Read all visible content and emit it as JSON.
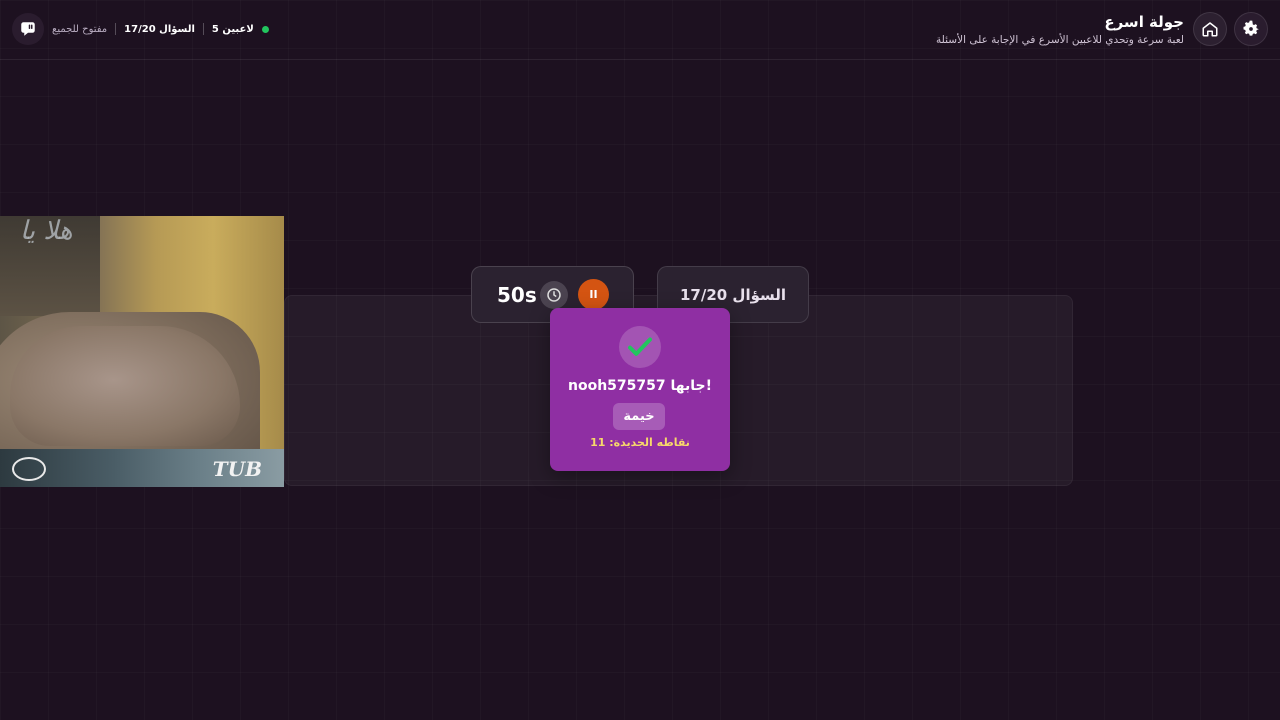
{
  "header": {
    "title": "جولة اسرع",
    "subtitle": "لعبة سرعة وتحدي للاعبين الأسرع في الإجابة على الأسئلة",
    "icons": {
      "settings": "gear-icon",
      "home": "home-icon",
      "chat": "chat-icon"
    }
  },
  "status": {
    "players": "5 لاعبين",
    "question": "السؤال 17/20",
    "mode": "مفتوح للجميع",
    "online_color": "#22c55e"
  },
  "game": {
    "timer": "50s",
    "question_label": "السؤال 17/20",
    "pause_glyph": "II",
    "accent_color": "#d45412"
  },
  "popup": {
    "winner_line": "nooh575757 جابها!",
    "answer": "خيمة",
    "points_line": "نقاطه الجديدة: 11",
    "background": "#8f2fa3",
    "check_color": "#22c55e"
  },
  "webcam": {
    "wall_text": "هلا يا",
    "logo": "TUB"
  }
}
